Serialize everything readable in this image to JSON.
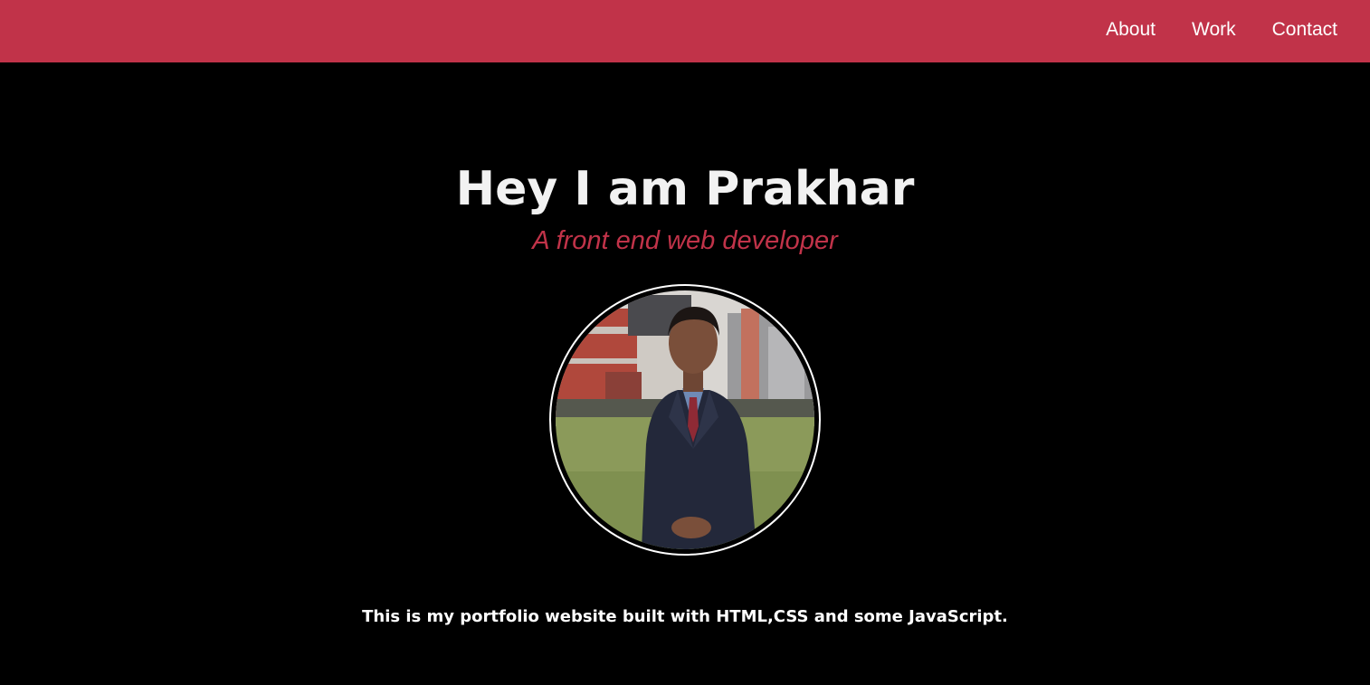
{
  "nav": {
    "links": [
      {
        "label": "About"
      },
      {
        "label": "Work"
      },
      {
        "label": "Contact"
      }
    ]
  },
  "hero": {
    "title": "Hey I am Prakhar",
    "subtitle": "A front end web developer",
    "description": "This is my portfolio website built with HTML,CSS and some JavaScript."
  },
  "colors": {
    "accent": "#c13349",
    "background": "#000000",
    "text": "#ffffff"
  }
}
